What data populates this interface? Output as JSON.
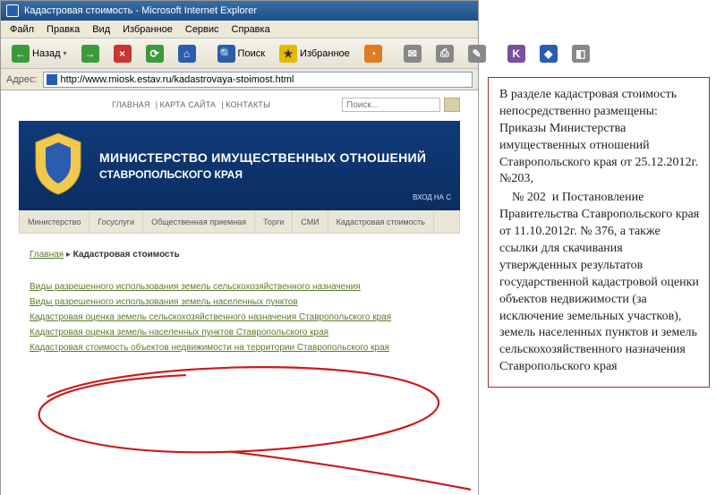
{
  "window": {
    "title": "Кадастровая стоимость - Microsoft Internet Explorer",
    "menus": {
      "file": "Файл",
      "edit": "Правка",
      "view": "Вид",
      "favorites": "Избранное",
      "tools": "Сервис",
      "help": "Справка"
    },
    "toolbar": {
      "back": "Назад",
      "search": "Поиск",
      "favorites_btn": "Избранное"
    },
    "address_label": "Адрес:",
    "url": "http://www.miosk.estav.ru/kadastrovaya-stoimost.html"
  },
  "page": {
    "topnav": {
      "main": "ГЛАВНАЯ",
      "sitemap": "КАРТА САЙТА",
      "contacts": "КОНТАКТЫ"
    },
    "search_placeholder": "Поиск...",
    "hero_line1": "МИНИСТЕРСТВО ИМУЩЕСТВЕННЫХ ОТНОШЕНИЙ",
    "hero_line2": "СТАВРОПОЛЬСКОГО КРАЯ",
    "login": "ВХОД НА С",
    "tabs": {
      "t1": "Министерство",
      "t2": "Госуслуги",
      "t3": "Общественная приемная",
      "t4": "Торги",
      "t5": "СМИ",
      "t6": "Кадастровая стоимость"
    },
    "breadcrumb_home": "Главная",
    "breadcrumb_sep": " ▸ ",
    "breadcrumb_current": "Кадастровая стоимость",
    "links": [
      "Виды разрешенного использования земель сельскохозяйственного назначения",
      "Виды разрешенного использования земель населенных пунктов",
      "Кадастровая оценка земель сельскохозяйственного назначения Ставропольского края",
      "Кадастровая оценка земель населенных пунктов Ставропольского края",
      "Кадастровая стоимость объектов недвижимости на территории Ставропольского края"
    ]
  },
  "annotation": {
    "p1": "В разделе кадастровая стоимость  непосредственно размещены: Приказы Министерства имущественных отношений Ставропольского края от 25.12.2012г. №203,",
    "p2": "    № 202  и Постановление Правительства Ставропольского края от 11.10.2012г. № 376, а также ссылки для скачивания утвержденных результатов государственной кадастровой оценки объектов недвижимости (за исключение земельных участков), земель населенных пунктов и земель сельскохозяйственного назначения Ставропольского края"
  }
}
